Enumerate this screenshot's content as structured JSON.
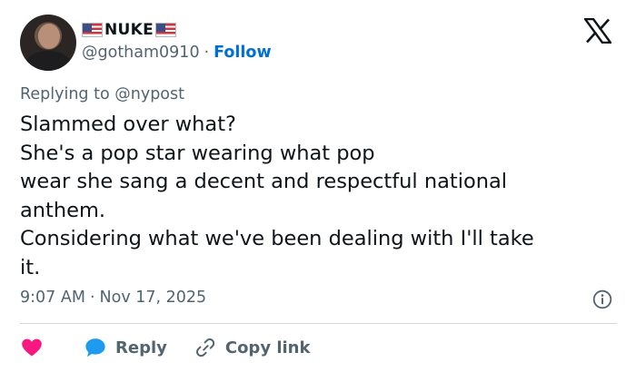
{
  "author": {
    "display_name": "NUKE",
    "handle": "@gotham0910",
    "separator": "·",
    "follow_label": "Follow"
  },
  "reply_context": {
    "prefix": "Replying to",
    "target": "@nypost"
  },
  "tweet": {
    "lines": [
      "Slammed over what?",
      "She's a pop star wearing what pop",
      "wear she sang a decent and respectful national",
      "anthem.",
      "Considering what we've been dealing with I'll take",
      "it."
    ],
    "time": "9:07 AM",
    "date": "Nov 17, 2025",
    "meta_separator": "·"
  },
  "actions": {
    "reply_label": "Reply",
    "copy_link_label": "Copy link"
  },
  "colors": {
    "accent": "#006fd6",
    "like": "#f91880",
    "reply_bubble": "#1d9bf0",
    "muted_text": "#536471",
    "divider": "#cfd9de"
  },
  "icons": [
    "us-flag-icon",
    "x-logo-icon",
    "info-icon",
    "heart-icon",
    "reply-bubble-icon",
    "link-icon"
  ]
}
